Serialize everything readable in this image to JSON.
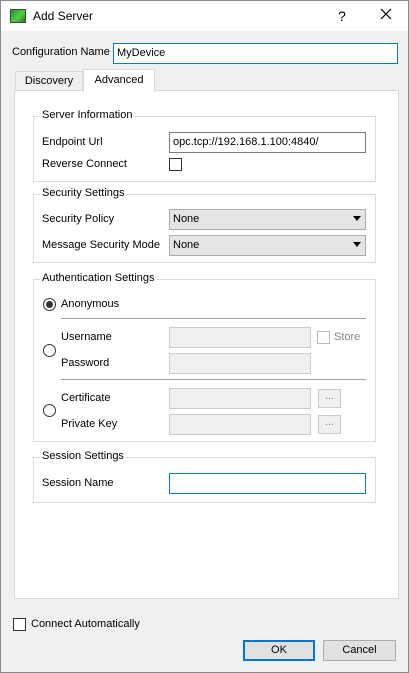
{
  "window": {
    "title": "Add Server",
    "help_glyph": "?"
  },
  "config": {
    "label": "Configuration Name",
    "value": "MyDevice"
  },
  "tabs": [
    {
      "label": "Discovery"
    },
    {
      "label": "Advanced"
    }
  ],
  "server_info": {
    "title": "Server Information",
    "endpoint_label": "Endpoint Url",
    "endpoint_value": "opc.tcp://192.168.1.100:4840/",
    "reverse_label": "Reverse Connect"
  },
  "security": {
    "title": "Security Settings",
    "policy_label": "Security Policy",
    "policy_value": "None",
    "mode_label": "Message Security Mode",
    "mode_value": "None"
  },
  "auth": {
    "title": "Authentication Settings",
    "anonymous_label": "Anonymous",
    "username_label": "Username",
    "password_label": "Password",
    "store_label": "Store",
    "certificate_label": "Certificate",
    "private_key_label": "Private Key",
    "browse_label": "..."
  },
  "session": {
    "title": "Session Settings",
    "name_label": "Session Name",
    "name_value": ""
  },
  "footer": {
    "auto_connect_label": "Connect Automatically",
    "ok_label": "OK",
    "cancel_label": "Cancel"
  }
}
